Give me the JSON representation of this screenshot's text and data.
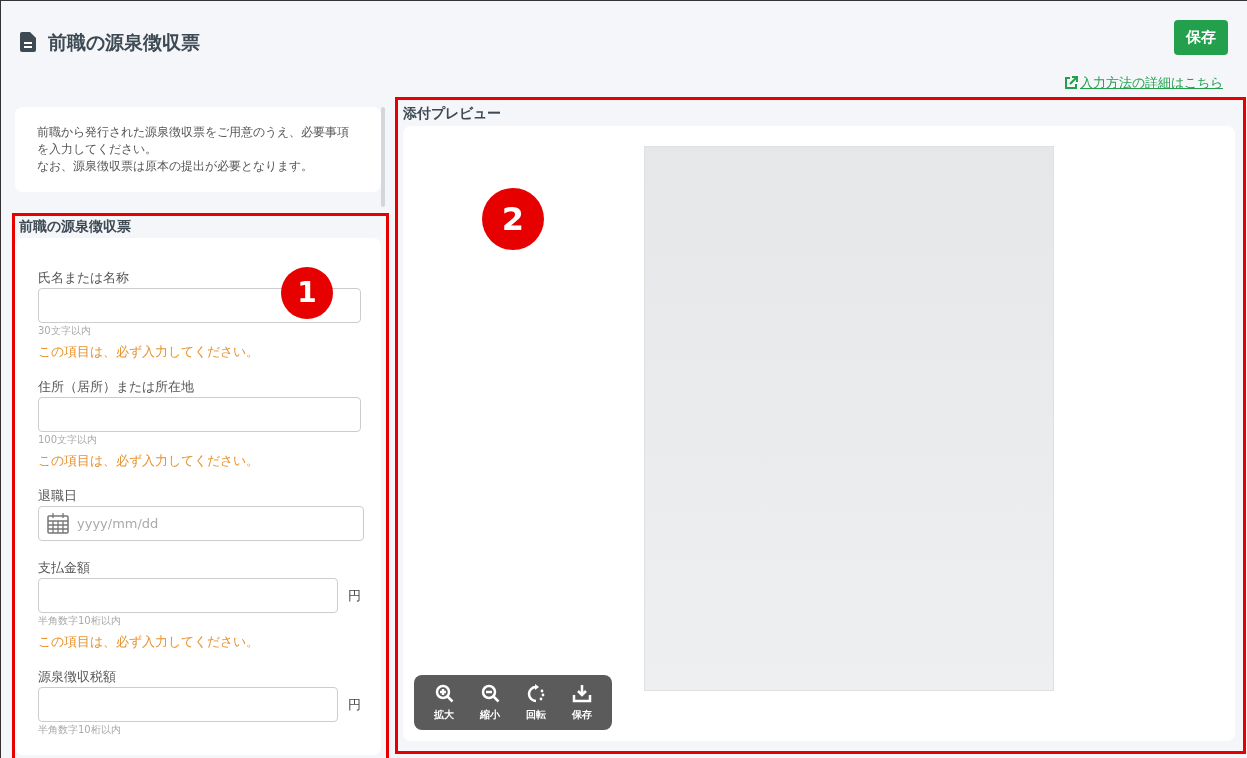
{
  "header": {
    "title": "前職の源泉徴収票",
    "save_button": "保存",
    "help_link": "入力方法の詳細はこちら"
  },
  "notice": {
    "lines": [
      "前職から発行された源泉徴収票をご用意のうえ、必要事項を入力してください。",
      "なお、源泉徴収票は原本の提出が必要となります。"
    ]
  },
  "form": {
    "title": "前職の源泉徴収票",
    "fields": [
      {
        "kind": "text",
        "label": "氏名または名称",
        "hint": "30文字以内",
        "error": "この項目は、必ず入力してください。"
      },
      {
        "kind": "text",
        "label": "住所（居所）または所在地",
        "hint": "100文字以内",
        "error": "この項目は、必ず入力してください。"
      },
      {
        "kind": "date",
        "label": "退職日",
        "placeholder": "yyyy/mm/dd"
      },
      {
        "kind": "amount",
        "label": "支払金額",
        "unit": "円",
        "hint": "半角数字10桁以内",
        "error": "この項目は、必ず入力してください。"
      },
      {
        "kind": "amount",
        "label": "源泉徴収税額",
        "unit": "円",
        "hint": "半角数字10桁以内"
      }
    ]
  },
  "preview": {
    "title": "添付プレビュー",
    "toolbar": [
      {
        "kind": "zoom_in",
        "label": "拡大"
      },
      {
        "kind": "zoom_out",
        "label": "縮小"
      },
      {
        "kind": "rotate",
        "label": "回転"
      },
      {
        "kind": "download",
        "label": "保存"
      }
    ]
  },
  "annotations": [
    {
      "number": "1"
    },
    {
      "number": "2"
    }
  ]
}
